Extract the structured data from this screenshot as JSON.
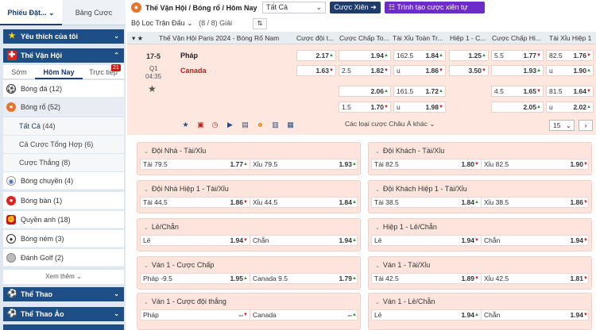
{
  "sidebar": {
    "tabs": [
      "Phiếu Đặt...",
      "Bảng Cược"
    ],
    "favorites": "Yêu thích của tôi",
    "olympics": "Thế Vận Hội",
    "subtabs": [
      "Sớm",
      "Hôm Nay",
      "Trực tiếp"
    ],
    "live_count": "21",
    "sports": [
      {
        "label": "Bóng đá",
        "count": "(12)",
        "icon": "soccer-icon"
      },
      {
        "label": "Bóng rổ",
        "count": "(52)",
        "icon": "basketball-icon"
      }
    ],
    "subitems": [
      {
        "label": "Tất Cả",
        "count": "(44)"
      },
      {
        "label": "Cả Cược Tổng Hợp",
        "count": "(6)"
      },
      {
        "label": "Cược Thắng",
        "count": "(8)"
      }
    ],
    "sports2": [
      {
        "label": "Bóng chuyền",
        "count": "(4)",
        "icon": "volleyball-icon"
      },
      {
        "label": "Bóng bàn",
        "count": "(1)",
        "icon": "ping-pong-icon"
      },
      {
        "label": "Quyền anh",
        "count": "(18)",
        "icon": "boxing-icon"
      },
      {
        "label": "Bóng ném",
        "count": "(3)",
        "icon": "handball-icon"
      },
      {
        "label": "Đánh Golf",
        "count": "(2)",
        "icon": "golf-icon"
      }
    ],
    "more": "Xem thêm",
    "sports_header": "Thể Thao",
    "virtual_header": "Thể Thao Ảo"
  },
  "topbar": {
    "breadcrumb": "Thế Vận Hội / Bóng rổ / Hôm Nay",
    "select": "Tất Cả",
    "parlay_button": "Cược Xiên",
    "auto_parlay_button": "Trình tạo cược xiên tự động",
    "filter_label": "Bộ Lọc Trận Đấu",
    "filter_count": "(8 / 8) Giải"
  },
  "table": {
    "league": "Thế Vận Hội Paris 2024 - Bóng Rổ Nam",
    "headers": [
      "Cược đội t...",
      "Cược Chấp To...",
      "Tài Xỉu Toàn Tr...",
      "Hiệp 1 - C...",
      "Cược Chấp Hi...",
      "Tài Xỉu Hiệp 1"
    ],
    "date": "17-5",
    "period": "Q1",
    "clock": "04:35",
    "home": "Pháp",
    "away": "Canada",
    "row1": {
      "ml": "2.17",
      "hdp": "1.94",
      "ou_line": "162.5",
      "ou": "1.84",
      "h1ml": "1.25",
      "h1hdp_line": "5.5",
      "h1hdp": "1.77",
      "h1ou_line": "82.5",
      "h1ou": "1.76"
    },
    "row2": {
      "ml": "1.63",
      "hdp_line": "2.5",
      "hdp": "1.82",
      "ou_line": "u",
      "ou": "1.86",
      "h1ml": "3.50",
      "h1hdp": "1.93",
      "h1ou_line": "u",
      "h1ou": "1.90"
    },
    "row3": {
      "hdp": "2.06",
      "ou_line": "161.5",
      "ou": "1.72",
      "h1hdp_line": "4.5",
      "h1hdp": "1.65",
      "h1ou_line": "81.5",
      "h1ou": "1.64"
    },
    "row4": {
      "hdp_line": "1.5",
      "hdp": "1.70",
      "ou_line": "u",
      "ou": "1.98",
      "h1hdp": "2.05",
      "h1ou_line": "u",
      "h1ou": "2.02"
    },
    "more_markets": "Các loại cược Châu Á khác",
    "page_select": "15"
  },
  "markets": [
    {
      "title": "Đội Nhà - Tài/Xỉu",
      "rows": [
        [
          "Tài 79.5",
          "1.77",
          "Xỉu 79.5",
          "1.93"
        ]
      ]
    },
    {
      "title": "Đội Khách - Tài/Xỉu",
      "rows": [
        [
          "Tài 82.5",
          "1.80",
          "Xỉu 82.5",
          "1.90"
        ]
      ]
    },
    {
      "title": "Đội Nhà Hiệp 1 - Tài/Xỉu",
      "rows": [
        [
          "Tài 44.5",
          "1.86",
          "Xỉu 44.5",
          "1.84"
        ]
      ]
    },
    {
      "title": "Đội Khách Hiệp 1 - Tài/Xỉu",
      "rows": [
        [
          "Tài 38.5",
          "1.84",
          "Xỉu 38.5",
          "1.86"
        ]
      ]
    },
    {
      "title": "Lẻ/Chẵn",
      "rows": [
        [
          "Lẻ",
          "1.94",
          "Chẵn",
          "1.94"
        ]
      ]
    },
    {
      "title": "Hiệp 1 - Lẻ/Chẵn",
      "rows": [
        [
          "Lẻ",
          "1.94",
          "Chẵn",
          "1.94"
        ]
      ]
    },
    {
      "title": "Ván 1 - Cược Chấp",
      "rows": [
        [
          "Pháp -9.5",
          "1.95",
          "Canada 9.5",
          "1.79"
        ]
      ]
    },
    {
      "title": "Ván 1 - Tài/Xỉu",
      "rows": [
        [
          "Tài 42.5",
          "1.89",
          "Xỉu 42.5",
          "1.81"
        ]
      ]
    },
    {
      "title": "Ván 1 - Cược đội thắng",
      "rows": [
        [
          "Pháp",
          "--",
          "Canada",
          "--"
        ]
      ]
    },
    {
      "title": "Ván 1 - Lẻ/Chẵn",
      "rows": [
        [
          "Lẻ",
          "1.94",
          "Chẵn",
          "1.94"
        ]
      ]
    }
  ],
  "colors": {
    "navy": "#1e4e86",
    "purple": "#6d2bc8",
    "market_bg": "#fde5dd",
    "up": "#2a9a2a",
    "down": "#c21b1b"
  }
}
